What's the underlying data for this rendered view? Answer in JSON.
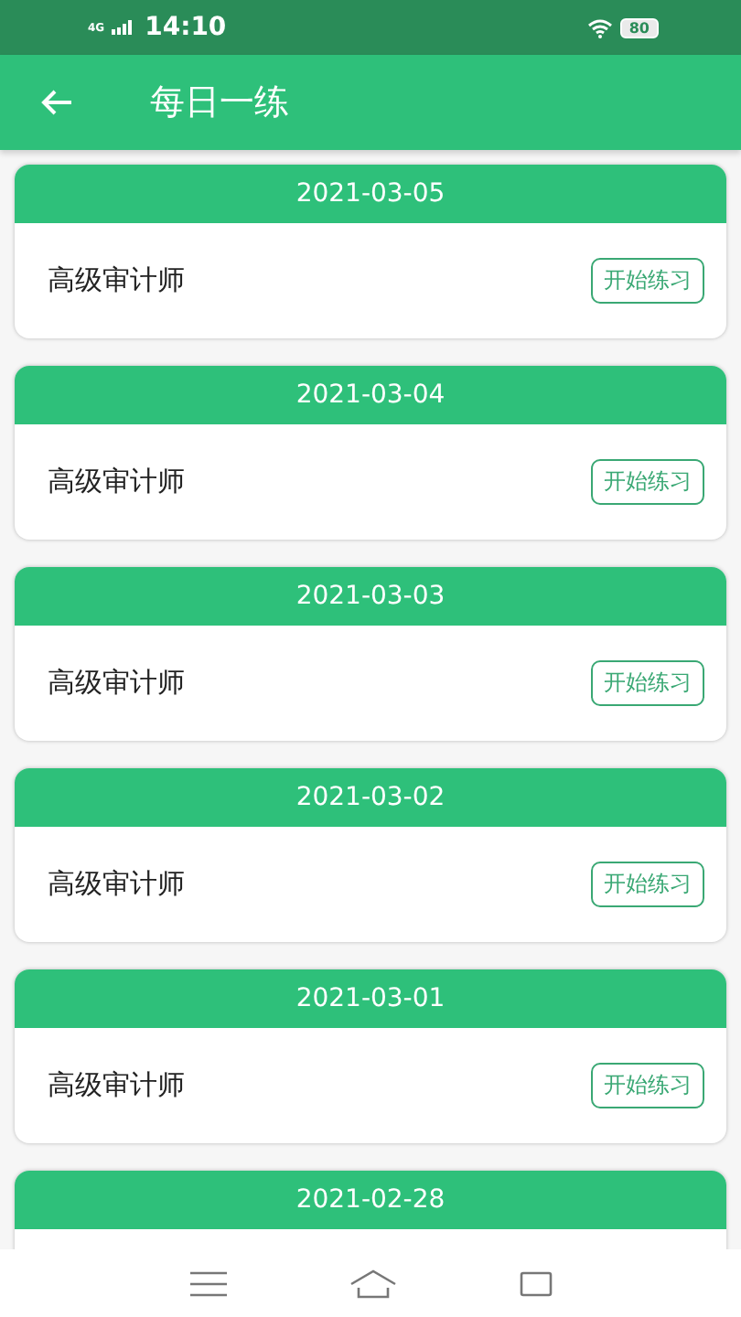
{
  "status_bar": {
    "network": "4G",
    "time": "14:10",
    "battery": "80"
  },
  "app_bar": {
    "title": "每日一练"
  },
  "practices": [
    {
      "date": "2021-03-05",
      "subject": "高级审计师",
      "action": "开始练习"
    },
    {
      "date": "2021-03-04",
      "subject": "高级审计师",
      "action": "开始练习"
    },
    {
      "date": "2021-03-03",
      "subject": "高级审计师",
      "action": "开始练习"
    },
    {
      "date": "2021-03-02",
      "subject": "高级审计师",
      "action": "开始练习"
    },
    {
      "date": "2021-03-01",
      "subject": "高级审计师",
      "action": "开始练习"
    },
    {
      "date": "2021-02-28"
    }
  ]
}
